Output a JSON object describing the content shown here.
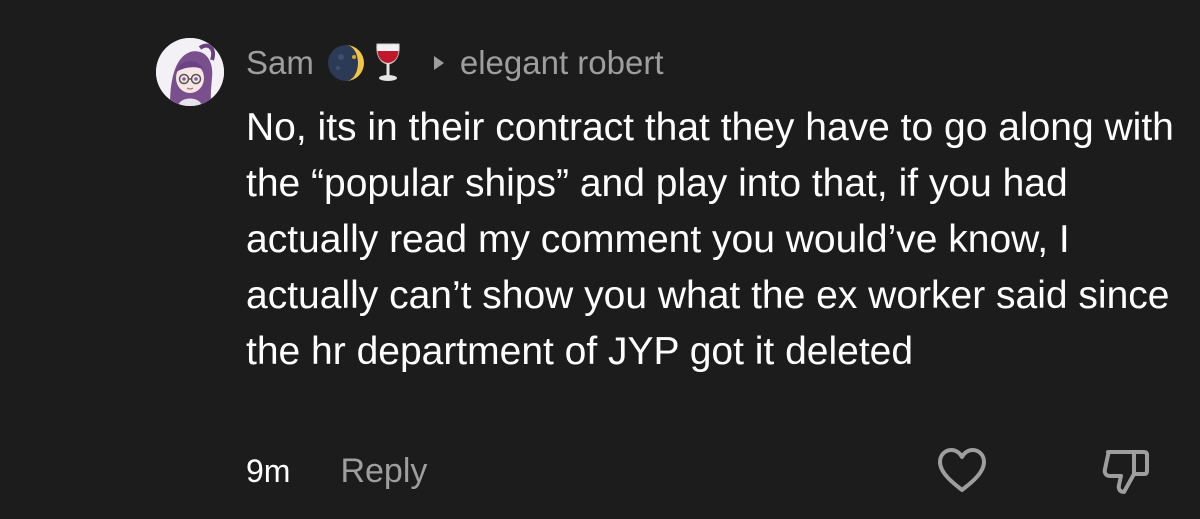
{
  "comment": {
    "username": "Sam",
    "badges": [
      "moon-icon",
      "wine-glass-icon"
    ],
    "reply_to": "elegant robert",
    "text": "No, its in their contract that they have to go along with the “popular ships” and play into that, if you had actually read my comment you would’ve know, I actually can’t show you what the ex worker said since the hr department of JYP got it deleted",
    "timestamp": "9m",
    "reply_label": "Reply"
  },
  "colors": {
    "background": "#1c1c1c",
    "text": "#ffffff",
    "muted": "#9e9e9e"
  }
}
